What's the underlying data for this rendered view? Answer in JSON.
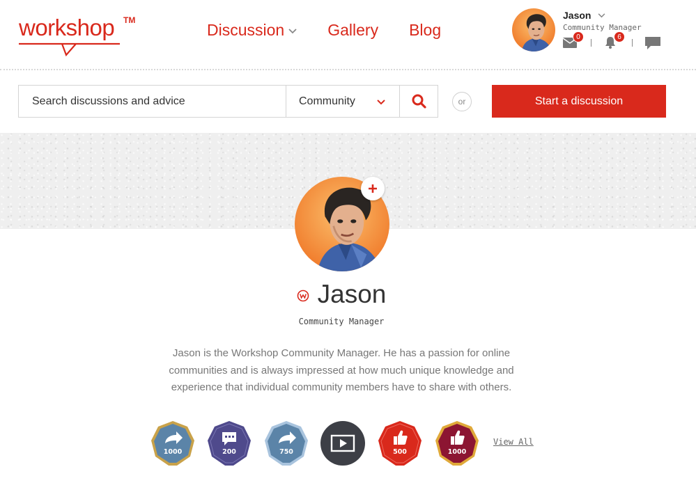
{
  "header": {
    "logo_text": "workshop",
    "logo_tm": "TM",
    "nav": {
      "discussion": "Discussion",
      "gallery": "Gallery",
      "blog": "Blog"
    },
    "user": {
      "name": "Jason",
      "role": "Community Manager",
      "messages_count": "0",
      "notifications_count": "6"
    }
  },
  "search": {
    "placeholder": "Search discussions and advice",
    "scope": "Community",
    "or_label": "or",
    "start_button": "Start a discussion"
  },
  "profile": {
    "name": "Jason",
    "role": "Community Manager",
    "bio": "Jason is the Workshop Community Manager. He has a passion for online communities and is always impressed at how much unique knowledge and experience that individual community members have to share with others."
  },
  "badges": [
    {
      "icon": "share-icon",
      "count": "1000",
      "color": "#5b84a8",
      "ring": "#c9a24a"
    },
    {
      "icon": "comment-icon",
      "count": "200",
      "color": "#4f4a8c",
      "ring": "#4f4a8c"
    },
    {
      "icon": "share-icon",
      "count": "750",
      "color": "#5b84a8",
      "ring": "#a9c4de"
    },
    {
      "icon": "video-icon",
      "count": "",
      "color": "#3d3f46",
      "ring": "#3d3f46"
    },
    {
      "icon": "thumbs-up-icon",
      "count": "500",
      "color": "#d9291c",
      "ring": "#d9291c"
    },
    {
      "icon": "thumbs-up-icon",
      "count": "1000",
      "color": "#8c1532",
      "ring": "#e0a93a"
    }
  ],
  "view_all": "View All",
  "colors": {
    "brand": "#d9291c",
    "text": "#333333",
    "muted": "#777777"
  }
}
